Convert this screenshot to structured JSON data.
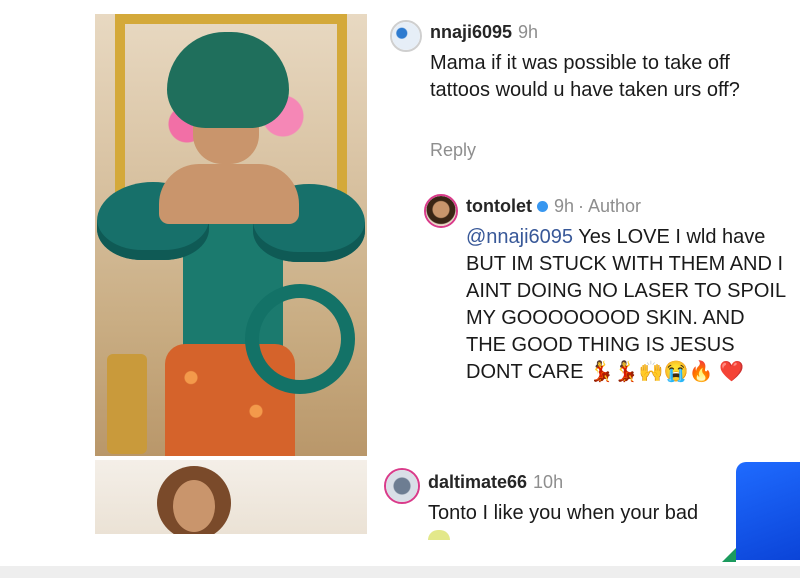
{
  "comments": [
    {
      "username": "nnaji6095",
      "time": "9h",
      "text": "Mama if it was possible to take off tattoos would u have taken urs off?",
      "reply_label": "Reply"
    },
    {
      "username": "tontolet",
      "time": "9h",
      "author_tag": "· Author",
      "mention": "@nnaji6095",
      "text": " Yes LOVE I wld have BUT IM STUCK WITH THEM AND I AINT DOING NO LASER TO SPOIL MY GOOOOOOOD SKIN. AND THE GOOD THING IS JESUS DONT CARE 💃💃🙌😭🔥 ❤️"
    },
    {
      "username": "daltimate66",
      "time": "10h",
      "text": "Tonto I like you when your bad"
    }
  ],
  "colors": {
    "accent": "#385898",
    "muted": "#8e8e8e",
    "verified": "#3897f0"
  },
  "icons": [
    "verified-badge-icon"
  ]
}
